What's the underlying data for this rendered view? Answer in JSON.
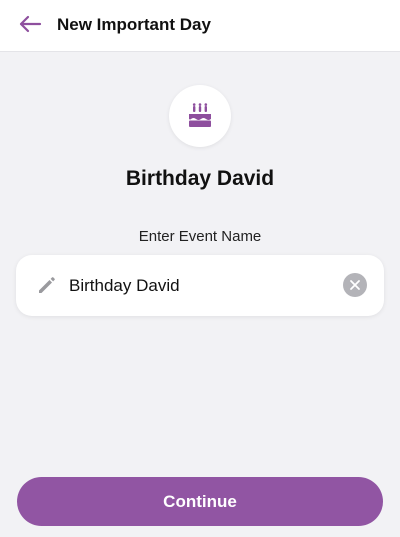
{
  "header": {
    "title": "New Important Day",
    "back_icon": "arrow-left-icon"
  },
  "event": {
    "icon": "birthday-cake-icon",
    "title": "Birthday David"
  },
  "form": {
    "label": "Enter Event Name",
    "value": "Birthday David",
    "edit_icon": "pencil-icon",
    "clear_icon": "clear-x-icon"
  },
  "actions": {
    "continue_label": "Continue"
  },
  "colors": {
    "accent": "#9155a3",
    "background": "#f2f2f5"
  }
}
